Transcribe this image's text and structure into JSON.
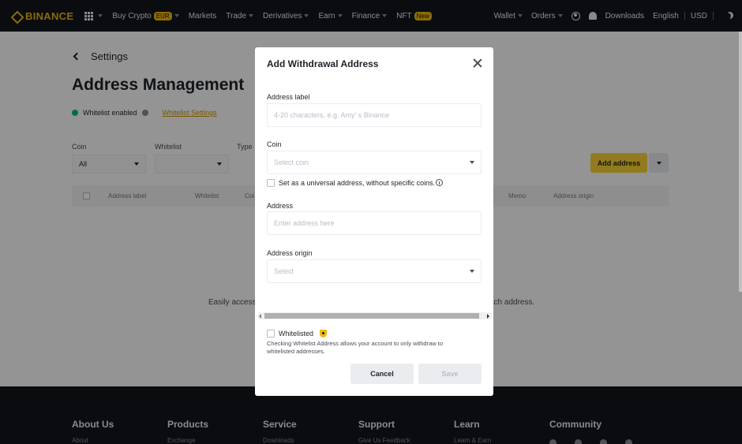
{
  "nav": {
    "brand": "BINANCE",
    "items": [
      {
        "label": "Buy Crypto",
        "badge": "EUR",
        "has_caret": true
      },
      {
        "label": "Markets",
        "badge": "",
        "has_caret": false
      },
      {
        "label": "Trade",
        "badge": "",
        "has_caret": true
      },
      {
        "label": "Derivatives",
        "badge": "",
        "has_caret": true
      },
      {
        "label": "Earn",
        "badge": "",
        "has_caret": true
      },
      {
        "label": "Finance",
        "badge": "",
        "has_caret": true
      },
      {
        "label": "NFT",
        "badge": "New",
        "has_caret": false
      }
    ],
    "wallet": "Wallet",
    "orders": "Orders",
    "downloads": "Downloads",
    "language": "English",
    "currency": "USD"
  },
  "page": {
    "back_label": "Settings",
    "title": "Address Management",
    "whitelist_status": "Whitelist enabled",
    "whitelist_settings": "Whitelist Settings",
    "filters": {
      "coin_label": "Coin",
      "coin_value": "All",
      "whitelist_label": "Whitelist",
      "whitelist_value": "",
      "type_label": "Type"
    },
    "add_address": "Add address",
    "table_headers": {
      "label": "Address label",
      "whitelist": "Whitelist",
      "coin": "Coi",
      "memo": "Memo",
      "origin": "Address origin"
    },
    "empty_left": "Easily access",
    "empty_right": "ach address."
  },
  "footer": {
    "columns": [
      {
        "title": "About Us",
        "first": "About"
      },
      {
        "title": "Products",
        "first": "Exchange"
      },
      {
        "title": "Service",
        "first": "Downloads"
      },
      {
        "title": "Support",
        "first": "Give Us Feedback"
      },
      {
        "title": "Learn",
        "first": "Learn & Earn"
      },
      {
        "title": "Community",
        "first": ""
      }
    ]
  },
  "modal": {
    "title": "Add Withdrawal Address",
    "address_label": "Address label",
    "address_label_placeholder": "4-20 characters, e.g. Amy' s Binance",
    "coin_label": "Coin",
    "coin_placeholder": "Select coin",
    "universal_text": "Set as a universal address, without specific coins.",
    "address_field_label": "Address",
    "address_placeholder": "Enter address here",
    "origin_label": "Address origin",
    "origin_placeholder": "Select",
    "whitelisted_label": "Whitelisted",
    "note": "Checking Whitelist Address allows your account to only withdraw to whitelisted addresses.",
    "cancel": "Cancel",
    "save": "Save"
  }
}
